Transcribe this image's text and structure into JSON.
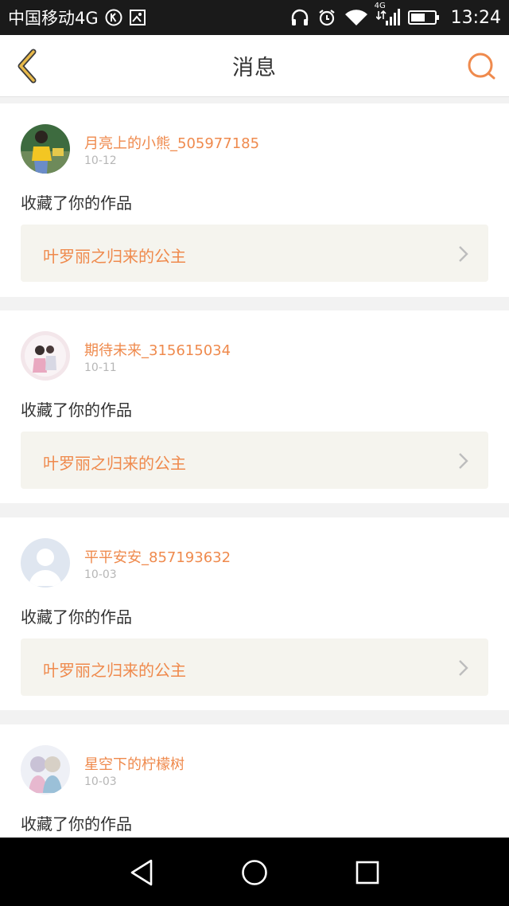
{
  "status_bar": {
    "carrier": "中国移动4G",
    "network_badge": "4G",
    "time": "13:24",
    "icons": [
      "k-circle-icon",
      "image-icon",
      "headphones-icon",
      "alarm-icon",
      "wifi-icon",
      "signal-icon",
      "battery-icon"
    ]
  },
  "header": {
    "title": "消息",
    "back_icon": "chevron-left-icon",
    "search_icon": "search-icon",
    "accent_color": "#ef8a4d"
  },
  "messages": [
    {
      "username": "月亮上的小熊_505977185",
      "date": "10-12",
      "action": "收藏了你的作品",
      "work_title": "叶罗丽之归来的公主",
      "avatar": "photo-yellow-shirt"
    },
    {
      "username": "期待未来_315615034",
      "date": "10-11",
      "action": "收藏了你的作品",
      "work_title": "叶罗丽之归来的公主",
      "avatar": "photo-pink-couple"
    },
    {
      "username": "平平安安_857193632",
      "date": "10-03",
      "action": "收藏了你的作品",
      "work_title": "叶罗丽之归来的公主",
      "avatar": "default-user-icon"
    },
    {
      "username": "星空下的柠檬树",
      "date": "10-03",
      "action": "收藏了你的作品",
      "work_title": "",
      "avatar": "anime-girls"
    }
  ],
  "system_nav": {
    "icons": [
      "back-triangle-icon",
      "home-circle-icon",
      "recents-square-icon"
    ]
  }
}
